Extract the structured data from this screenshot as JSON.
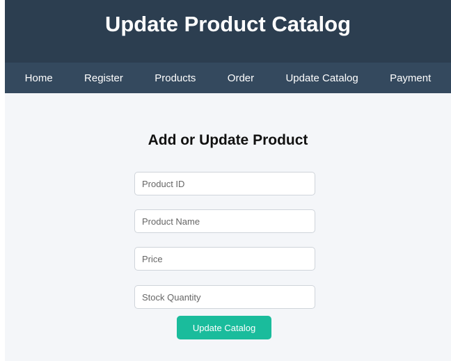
{
  "header": {
    "title": "Update Product Catalog"
  },
  "nav": {
    "items": [
      {
        "label": "Home"
      },
      {
        "label": "Register"
      },
      {
        "label": "Products"
      },
      {
        "label": "Order"
      },
      {
        "label": "Update Catalog"
      },
      {
        "label": "Payment"
      }
    ]
  },
  "form": {
    "title": "Add or Update Product",
    "fields": {
      "product_id": {
        "placeholder": "Product ID",
        "value": ""
      },
      "product_name": {
        "placeholder": "Product Name",
        "value": ""
      },
      "price": {
        "placeholder": "Price",
        "value": ""
      },
      "stock_quantity": {
        "placeholder": "Stock Quantity",
        "value": ""
      }
    },
    "submit_label": "Update Catalog"
  },
  "colors": {
    "header_bg": "#2c3e50",
    "nav_bg": "#34495e",
    "page_bg": "#f4f6f9",
    "button_accent": "#1abc9c"
  }
}
